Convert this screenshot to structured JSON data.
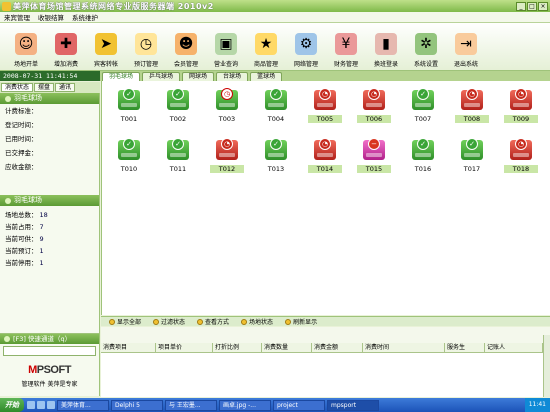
{
  "window": {
    "title": "美萍体育场馆管理系统网络专业版服务器端 2010v2",
    "buttons": [
      "_",
      "□",
      "×"
    ]
  },
  "menu": [
    "来宾管理",
    "收银结算",
    "系统维护"
  ],
  "toolbar": [
    {
      "label": "场地开单",
      "icon": "person-icon",
      "color": "#f4b183"
    },
    {
      "label": "增加消费",
      "icon": "gift-icon",
      "color": "#e06666"
    },
    {
      "label": "宾客转帐",
      "icon": "arrows-icon",
      "color": "#f1c232"
    },
    {
      "label": "预订管理",
      "icon": "clock-icon",
      "color": "#ffe599"
    },
    {
      "label": "会员管理",
      "icon": "group-icon",
      "color": "#f6b26b"
    },
    {
      "label": "营业查询",
      "icon": "monitor-icon",
      "color": "#b6d7a8"
    },
    {
      "label": "商品管理",
      "icon": "star-icon",
      "color": "#ffd966"
    },
    {
      "label": "网络管理",
      "icon": "network-icon",
      "color": "#9fc5e8"
    },
    {
      "label": "财务管理",
      "icon": "finance-icon",
      "color": "#ea9999"
    },
    {
      "label": "换班登录",
      "icon": "door-icon",
      "color": "#e6b8af"
    },
    {
      "label": "系统设置",
      "icon": "gears-icon",
      "color": "#93c47d"
    },
    {
      "label": "退出系统",
      "icon": "exit-icon",
      "color": "#f9cb9c"
    }
  ],
  "datetime": "2008-07-31 11:41:54",
  "left_tabs": [
    "消费状态",
    "摆盘",
    "通讯"
  ],
  "court_tabs": [
    "羽毛球场",
    "乒乓球场",
    "网球场",
    "台球场",
    "篮球场"
  ],
  "detail_panel": {
    "title": "羽毛球场",
    "fields": [
      "计费标准：",
      "登记时间：",
      "已用时间：",
      "已交押金：",
      "应收金额："
    ]
  },
  "stats_panel": {
    "title": "羽毛球场",
    "rows": [
      {
        "label": "场地总数：",
        "value": "18"
      },
      {
        "label": "当前占用：",
        "value": "7"
      },
      {
        "label": "当前可供：",
        "value": "9"
      },
      {
        "label": "当前预订：",
        "value": "1"
      },
      {
        "label": "当前停用：",
        "value": "1"
      }
    ]
  },
  "quick_panel": {
    "title": "[F3] 快速通道（q）",
    "logo_main": "PSOFT",
    "logo_prefix": "M",
    "slogan": "管理软件 美萍是专家"
  },
  "courts": [
    {
      "name": "T001",
      "status": "idle"
    },
    {
      "name": "T002",
      "status": "idle"
    },
    {
      "name": "T003",
      "status": "reserved"
    },
    {
      "name": "T004",
      "status": "idle"
    },
    {
      "name": "T005",
      "status": "busy"
    },
    {
      "name": "T006",
      "status": "busy"
    },
    {
      "name": "T007",
      "status": "idle"
    },
    {
      "name": "T008",
      "status": "busy"
    },
    {
      "name": "T009",
      "status": "busy"
    },
    {
      "name": "T010",
      "status": "idle"
    },
    {
      "name": "T011",
      "status": "idle"
    },
    {
      "name": "T012",
      "status": "busy"
    },
    {
      "name": "T013",
      "status": "idle"
    },
    {
      "name": "T014",
      "status": "busy"
    },
    {
      "name": "T015",
      "status": "stopped"
    },
    {
      "name": "T016",
      "status": "idle"
    },
    {
      "name": "T017",
      "status": "idle"
    },
    {
      "name": "T018",
      "status": "busy"
    }
  ],
  "court_toolbar": [
    "显示全部",
    "过滤状态",
    "查看方式",
    "场地状态",
    "刷新显示"
  ],
  "grid_columns": [
    "消费项目",
    "项目单价",
    "打折比例",
    "消费数量",
    "消费金额",
    "消费时间",
    "服务生",
    "记账人"
  ],
  "taskbar": {
    "start": "开始",
    "tasks": [
      "美萍体育...",
      "Delphi 5",
      "与 王宏墨...",
      "画卓.jpg -...",
      "project",
      "mpsport"
    ],
    "clock": "11:41"
  }
}
